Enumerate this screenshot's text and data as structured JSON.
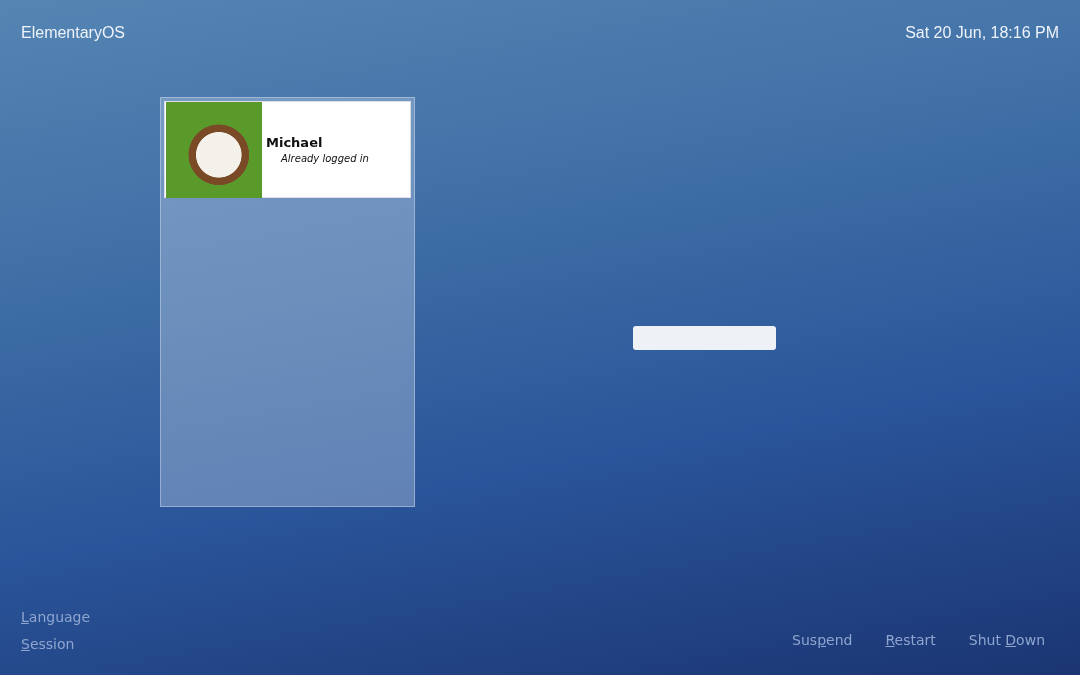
{
  "top_bar": {
    "hostname": "ElementaryOS",
    "clock": "Sat 20 Jun, 18:16 PM"
  },
  "users": [
    {
      "name": "Michael",
      "status": "Already logged in",
      "selected": true
    }
  ],
  "options": [
    {
      "key": "L",
      "after": "anguage"
    },
    {
      "key": "S",
      "after": "ession"
    }
  ],
  "power_buttons": [
    {
      "before": "Sus",
      "key": "p",
      "after": "end"
    },
    {
      "key": "R",
      "after": "estart"
    },
    {
      "before": "Shut ",
      "key": "D",
      "after": "own"
    }
  ]
}
